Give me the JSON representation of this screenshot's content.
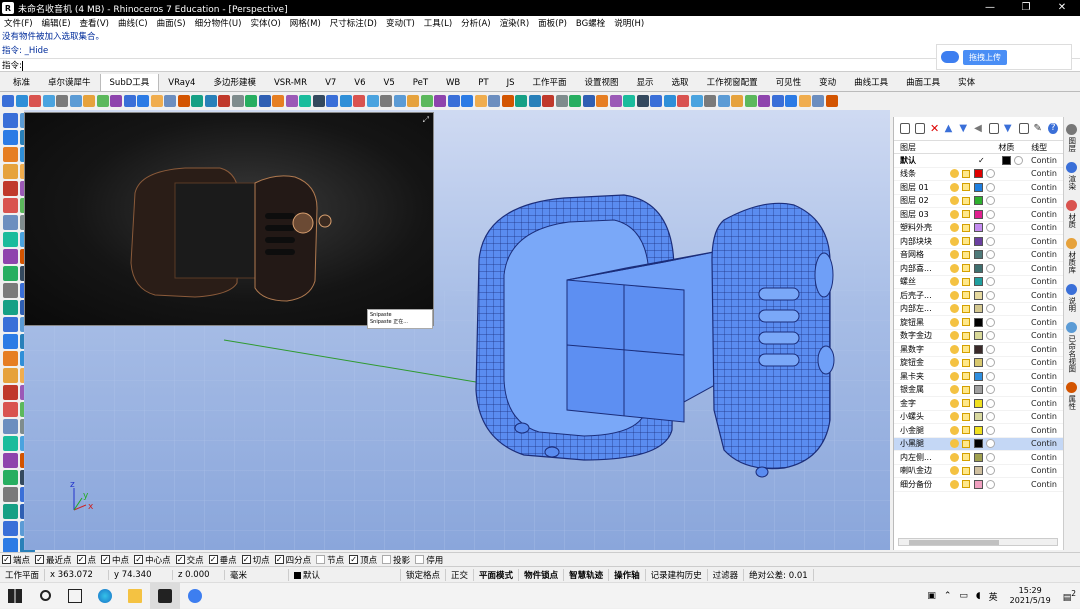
{
  "window": {
    "title": "未命名收音机 (4 MB) - Rhinoceros 7 Education - [Perspective]",
    "minimize": "—",
    "maximize": "❐",
    "close": "✕"
  },
  "menu": [
    "文件(F)",
    "编辑(E)",
    "查看(V)",
    "曲线(C)",
    "曲面(S)",
    "细分物件(U)",
    "实体(O)",
    "网格(M)",
    "尺寸标注(D)",
    "变动(T)",
    "工具(L)",
    "分析(A)",
    "渲染(R)",
    "面板(P)",
    "BG螺栓",
    "说明(H)"
  ],
  "command": {
    "history1": "没有物件被加入选取集合。",
    "history2": "指令: _Hide",
    "prompt": "指令:"
  },
  "upload_button": {
    "label": "拖拽上传"
  },
  "tabs": [
    "标准",
    "卓尔谟犀牛",
    "SubD工具",
    "VRay4",
    "多边形建模",
    "VSR-MR",
    "V7",
    "V6",
    "V5",
    "PeT",
    "WB",
    "PT",
    "JS",
    "工作平面",
    "设置视图",
    "显示",
    "选取",
    "工作视窗配置",
    "可见性",
    "变动",
    "曲线工具",
    "曲面工具",
    "实体"
  ],
  "active_tab": "SubD工具",
  "toolbar_colors": [
    "#3a6fd8",
    "#2f8fd8",
    "#d9534f",
    "#4aa3df",
    "#7a7a7a",
    "#5b9bd5",
    "#e6a23c",
    "#5cb85c",
    "#8e44ad",
    "#3a6fd8",
    "#2c7be5",
    "#f0ad4e",
    "#6c8ebf",
    "#d35400",
    "#16a085",
    "#2980b9",
    "#c0392b",
    "#7f8c8d",
    "#27ae60",
    "#2f5fb3",
    "#e67e22",
    "#9b59b6",
    "#1abc9c",
    "#34495e"
  ],
  "layer_panel": {
    "headers": {
      "layer": "图层",
      "material": "材质",
      "linetype": "线型"
    },
    "layers": [
      {
        "name": "默认",
        "current": "✓",
        "color": "#000000",
        "linetype": "Contin",
        "bold": true
      },
      {
        "name": "线条",
        "color": "#e00000",
        "linetype": "Contin"
      },
      {
        "name": "图层 01",
        "color": "#1f7fe0",
        "linetype": "Contin"
      },
      {
        "name": "图层 02",
        "color": "#2fb02f",
        "linetype": "Contin"
      },
      {
        "name": "图层 03",
        "color": "#e0208f",
        "linetype": "Contin"
      },
      {
        "name": "塑料外壳",
        "color": "#c48cf0",
        "linetype": "Contin"
      },
      {
        "name": "内部块块",
        "color": "#6a3fa0",
        "linetype": "Contin"
      },
      {
        "name": "音网格",
        "color": "#4f7a7a",
        "linetype": "Contin"
      },
      {
        "name": "内部喜...",
        "color": "#3f6f6f",
        "linetype": "Contin"
      },
      {
        "name": "螺丝",
        "color": "#1f9f9f",
        "linetype": "Contin"
      },
      {
        "name": "后壳子...",
        "color": "#e6d9a0",
        "linetype": "Contin"
      },
      {
        "name": "内部左...",
        "color": "#d4c890",
        "linetype": "Contin"
      },
      {
        "name": "旋钮黑",
        "color": "#000000",
        "linetype": "Contin"
      },
      {
        "name": "数字金边",
        "color": "#d9d99a",
        "linetype": "Contin"
      },
      {
        "name": "黑数字",
        "color": "#3a2a2a",
        "linetype": "Contin"
      },
      {
        "name": "旋钮金",
        "color": "#d8c86f",
        "linetype": "Contin"
      },
      {
        "name": "黑卡夹",
        "color": "#2f8fe0",
        "linetype": "Contin"
      },
      {
        "name": "银金属",
        "color": "#a0a0a0",
        "linetype": "Contin"
      },
      {
        "name": "金字",
        "color": "#f0e020",
        "linetype": "Contin"
      },
      {
        "name": "小螺头",
        "color": "#d9d9a0",
        "linetype": "Contin"
      },
      {
        "name": "小金腿",
        "color": "#f0e020",
        "linetype": "Contin"
      },
      {
        "name": "小黑腿",
        "color": "#000000",
        "linetype": "Contin",
        "selected": true
      },
      {
        "name": "内左侧...",
        "color": "#a0a050",
        "linetype": "Contin"
      },
      {
        "name": "喇叭金边",
        "color": "#d0c0a0",
        "linetype": "Contin"
      },
      {
        "name": "细分备份",
        "color": "#f0a0c0",
        "linetype": "Contin"
      }
    ]
  },
  "side_tabs": [
    "图层",
    "渲染",
    "材质",
    "材质库",
    "说明",
    "已命名视图",
    "属性"
  ],
  "snaps": [
    {
      "label": "端点",
      "on": true
    },
    {
      "label": "最近点",
      "on": true
    },
    {
      "label": "点",
      "on": true
    },
    {
      "label": "中点",
      "on": true
    },
    {
      "label": "中心点",
      "on": true
    },
    {
      "label": "交点",
      "on": true
    },
    {
      "label": "垂点",
      "on": true
    },
    {
      "label": "切点",
      "on": true
    },
    {
      "label": "四分点",
      "on": true
    },
    {
      "label": "节点",
      "on": false
    },
    {
      "label": "顶点",
      "on": true
    },
    {
      "label": "投影",
      "on": false
    },
    {
      "label": "停用",
      "on": false
    }
  ],
  "status": {
    "cplane": "工作平面",
    "x": "x 363.072",
    "y": "y 74.340",
    "z": "z 0.000",
    "unit": "毫米",
    "layer": "默认",
    "items": [
      "锁定格点",
      "正交",
      "平面模式",
      "物件锁点",
      "智慧轨迹",
      "操作轴",
      "记录建构历史",
      "过滤器",
      "绝对公差: 0.01"
    ],
    "bold_items": [
      "平面模式",
      "物件锁点",
      "智慧轨迹",
      "操作轴"
    ]
  },
  "axes": {
    "x": "x",
    "y": "y",
    "z": "z"
  },
  "preview": {
    "corner": "⤢",
    "snip_title": "Snipaste",
    "snip_text": "Snipaste 正在..."
  },
  "taskbar": {
    "time": "15:29",
    "date": "2021/5/19",
    "ime": "英",
    "notify": "2"
  }
}
